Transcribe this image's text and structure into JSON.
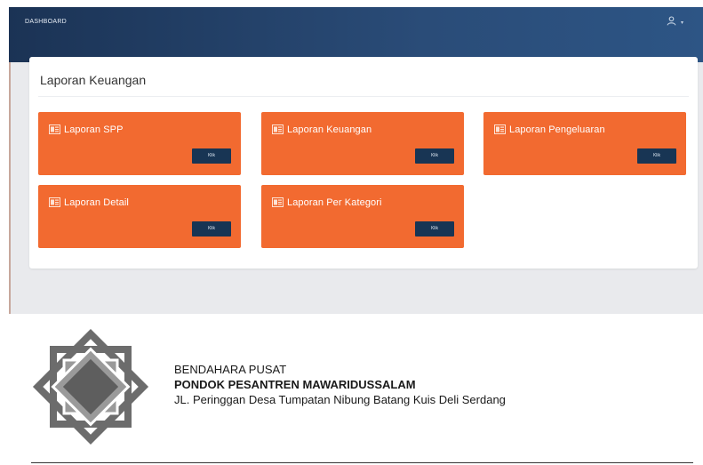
{
  "header": {
    "brand": "DASHBOARD",
    "user_menu_caret": "▾"
  },
  "card": {
    "title": "Laporan Keuangan"
  },
  "tiles": [
    {
      "label": "Laporan SPP",
      "button": "Klik"
    },
    {
      "label": "Laporan Keuangan",
      "button": "Klik"
    },
    {
      "label": "Laporan Pengeluaran",
      "button": "Klik"
    },
    {
      "label": "Laporan Detail",
      "button": "Klik"
    },
    {
      "label": "Laporan Per Kategori",
      "button": "Klik"
    }
  ],
  "letterhead": {
    "line1": "BENDAHARA PUSAT",
    "line2": "PONDOK PESANTREN MAWARIDUSSALAM",
    "line3": "JL. Peringgan Desa Tumpatan Nibung Batang Kuis Deli Serdang"
  },
  "colors": {
    "header": "#1b3355",
    "tile": "#f26a30",
    "tile_button": "#183554",
    "card": "#ffffff",
    "app_bg": "#e9eaed"
  },
  "icons": {
    "user": "user-icon",
    "tile": "report-icon",
    "logo": "star-octagon-logo"
  }
}
